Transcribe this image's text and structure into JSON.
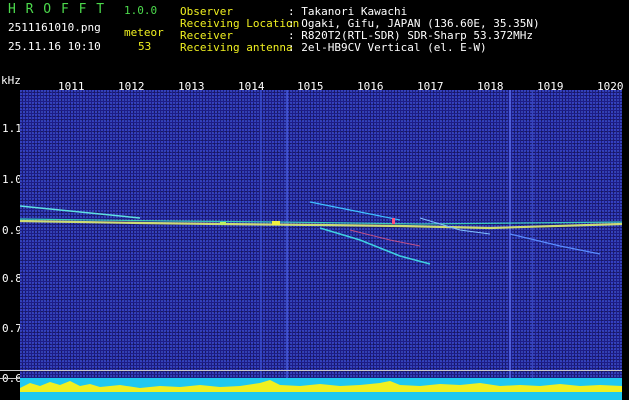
{
  "header": {
    "app_title": "H R O F F T",
    "version": "1.0.0",
    "filename": "2511161010.png",
    "datetime": "25.11.16 10:10",
    "count_label": "meteor",
    "count_value": "53"
  },
  "info": [
    {
      "key": "Observer",
      "value": ": Takanori Kawachi"
    },
    {
      "key": "Receiving Location",
      "value": ": Ogaki, Gifu, JAPAN (136.60E, 35.35N)"
    },
    {
      "key": "Receiver",
      "value": ": R820T2(RTL-SDR) SDR-Sharp 53.372MHz"
    },
    {
      "key": "Receiving antenna",
      "value": ": 2el-HB9CV Vertical (el. E-W)"
    }
  ],
  "plot": {
    "y_unit": "kHz",
    "time_labels": [
      "1011",
      "1012",
      "1013",
      "1014",
      "1015",
      "1016",
      "1017",
      "1018",
      "1019",
      "1020"
    ],
    "freq_labels": [
      "1.1",
      "1.0",
      "0.9",
      "0.8",
      "0.7",
      "0.6"
    ]
  },
  "colors": {
    "header_green": "#4cd94c",
    "header_yellow": "#f0f020",
    "background": "#1d1d86",
    "amplitude": "#f0f020",
    "baseline": "#20c8f0"
  }
}
